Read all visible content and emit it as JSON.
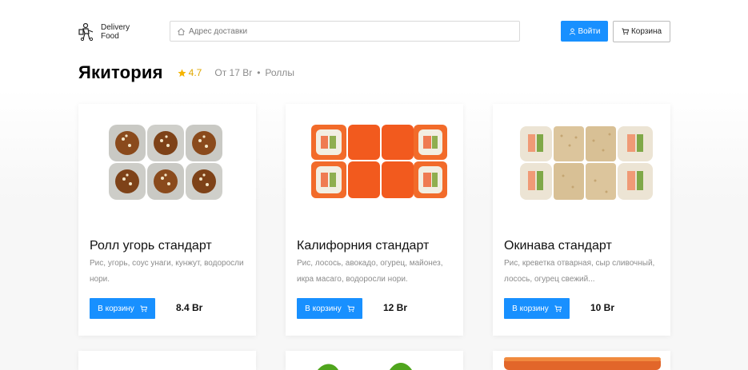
{
  "header": {
    "logo_line1": "Delivery",
    "logo_line2": "Food",
    "search_placeholder": "Адрес доставки",
    "login_label": "Войти",
    "cart_label": "Корзина"
  },
  "restaurant": {
    "name": "Якитория",
    "rating": "4.7",
    "price_from": "От 17 Br",
    "separator": "•",
    "category": "Роллы"
  },
  "colors": {
    "accent": "#1890ff",
    "star": "#f5b400",
    "muted_text": "#8c8c8c"
  },
  "add_to_cart_label": "В корзину",
  "products": [
    {
      "title": "Ролл угорь стандарт",
      "description": "Рис, угорь, соус унаги, кунжут, водоросли нори.",
      "price": "8.4 Br",
      "image": "eel-roll-image"
    },
    {
      "title": "Калифорния стандарт",
      "description": "Рис, лосось, авокадо, огурец, майонез, икра масаго, водоросли нори.",
      "price": "12 Br",
      "image": "california-roll-image"
    },
    {
      "title": "Окинава стандарт",
      "description": "Рис, креветка отварная, сыр сливочный, лосось, огурец свежий...",
      "price": "10 Br",
      "image": "okinawa-roll-image"
    }
  ]
}
